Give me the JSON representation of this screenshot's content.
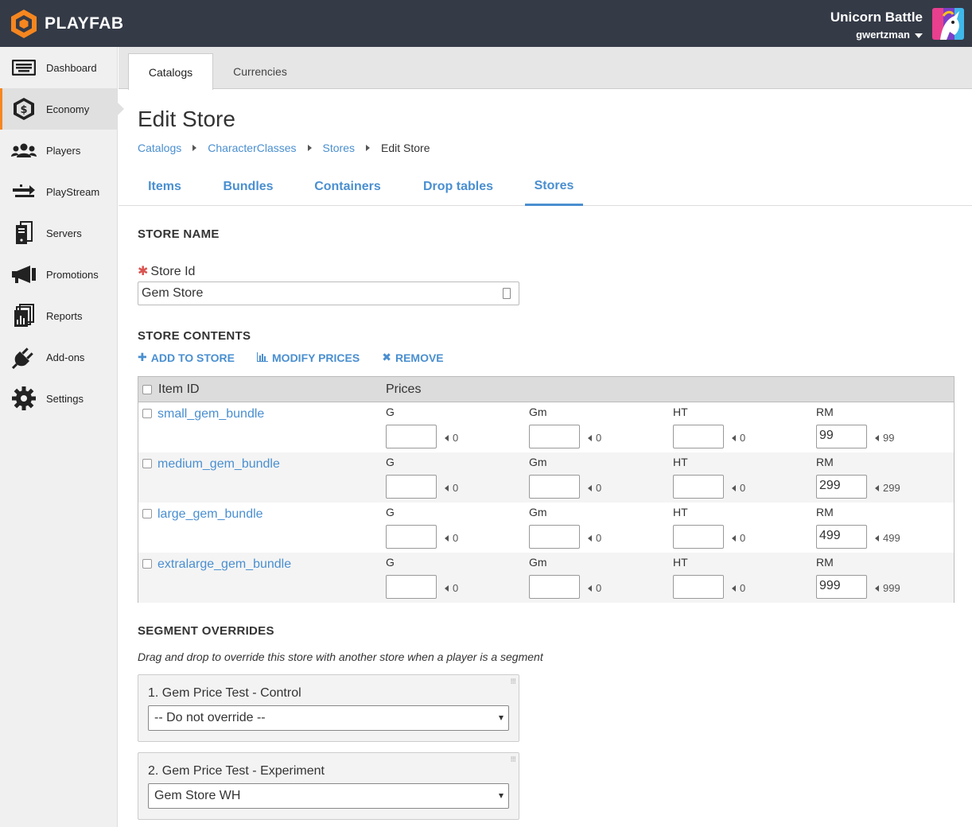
{
  "header": {
    "logo_text": "PLAYFAB",
    "app_title": "Unicorn Battle",
    "username": "gwertzman",
    "colors": {
      "bar": "#343a46",
      "brand": "#f6861f"
    }
  },
  "sidebar": {
    "items": [
      {
        "label": "Dashboard",
        "icon": "keyboard-icon"
      },
      {
        "label": "Economy",
        "icon": "dollar-hexagon-icon",
        "active": true
      },
      {
        "label": "Players",
        "icon": "people-icon"
      },
      {
        "label": "PlayStream",
        "icon": "stream-arrows-icon"
      },
      {
        "label": "Servers",
        "icon": "server-icon"
      },
      {
        "label": "Promotions",
        "icon": "megaphone-icon"
      },
      {
        "label": "Reports",
        "icon": "report-chart-icon"
      },
      {
        "label": "Add-ons",
        "icon": "plug-icon"
      },
      {
        "label": "Settings",
        "icon": "gear-icon"
      }
    ]
  },
  "top_tabs": {
    "catalogs": "Catalogs",
    "currencies": "Currencies"
  },
  "page": {
    "title": "Edit Store",
    "breadcrumb": [
      "Catalogs",
      "CharacterClasses",
      "Stores",
      "Edit Store"
    ]
  },
  "sub_tabs": [
    "Items",
    "Bundles",
    "Containers",
    "Drop tables",
    "Stores"
  ],
  "store_name": {
    "section": "STORE NAME",
    "label": "Store Id",
    "value": "Gem Store"
  },
  "store_contents": {
    "section": "STORE CONTENTS",
    "actions": {
      "add": "ADD TO STORE",
      "modify": "MODIFY PRICES",
      "remove": "REMOVE"
    },
    "headers": {
      "item_id": "Item ID",
      "prices": "Prices"
    },
    "currencies": [
      "G",
      "Gm",
      "HT",
      "RM"
    ],
    "rows": [
      {
        "item": "small_gem_bundle",
        "values": [
          "",
          "",
          "",
          "99"
        ],
        "previous": [
          "0",
          "0",
          "0",
          "99"
        ]
      },
      {
        "item": "medium_gem_bundle",
        "values": [
          "",
          "",
          "",
          "299"
        ],
        "previous": [
          "0",
          "0",
          "0",
          "299"
        ]
      },
      {
        "item": "large_gem_bundle",
        "values": [
          "",
          "",
          "",
          "499"
        ],
        "previous": [
          "0",
          "0",
          "0",
          "499"
        ]
      },
      {
        "item": "extralarge_gem_bundle",
        "values": [
          "",
          "",
          "",
          "999"
        ],
        "previous": [
          "0",
          "0",
          "0",
          "999"
        ]
      }
    ]
  },
  "segment_overrides": {
    "section": "SEGMENT OVERRIDES",
    "description": "Drag and drop to override this store with another store when a player is a segment",
    "segments": [
      {
        "title": "1. Gem Price Test - Control",
        "selected": "-- Do not override --"
      },
      {
        "title": "2. Gem Price Test - Experiment",
        "selected": "Gem Store WH"
      }
    ]
  }
}
